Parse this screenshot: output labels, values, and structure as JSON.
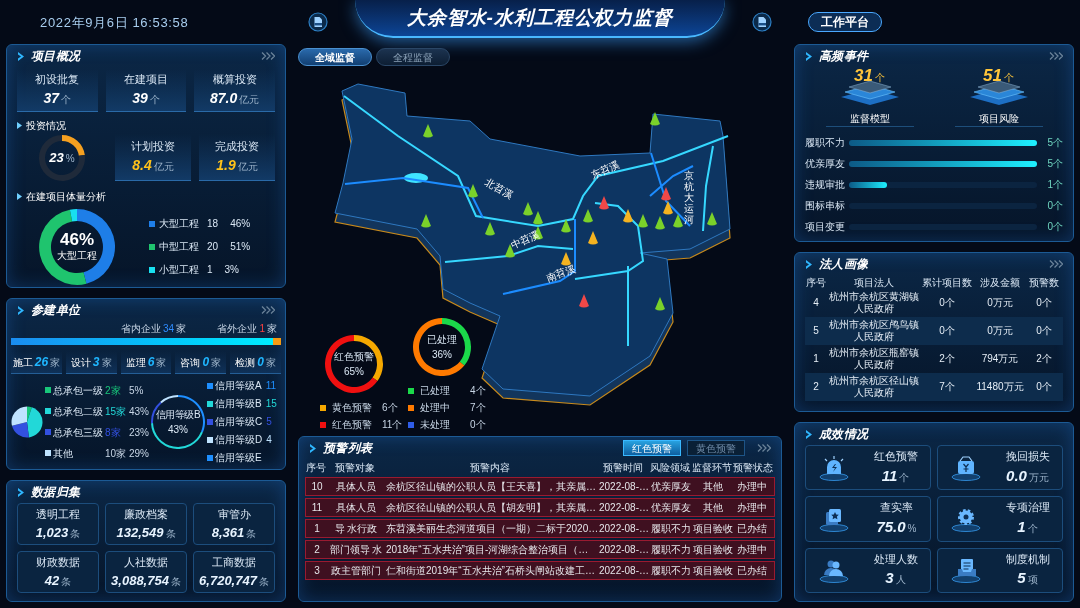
{
  "header": {
    "datetime": "2022年9月6日 16:53:58",
    "title": "大余智水-水利工程公权力监督",
    "workbench_button": "工作平台"
  },
  "overview": {
    "title": "项目概况",
    "stats": [
      {
        "label": "初设批复",
        "value": "37",
        "unit": "个"
      },
      {
        "label": "在建项目",
        "value": "39",
        "unit": "个"
      },
      {
        "label": "概算投资",
        "value": "87.0",
        "unit": "亿元"
      }
    ],
    "investment_title": "投资情况",
    "investment_ring": {
      "value": "23",
      "unit": "%",
      "chart_data": {
        "type": "donut",
        "values": [
          23,
          77
        ]
      }
    },
    "investment_stats": [
      {
        "label": "计划投资",
        "value": "8.4",
        "unit": "亿元"
      },
      {
        "label": "完成投资",
        "value": "1.9",
        "unit": "亿元"
      }
    ],
    "scale_title": "在建项目体量分析",
    "scale_center": {
      "value": "46%",
      "label": "大型工程"
    },
    "chart_data": {
      "type": "donut",
      "categories": [
        "大型工程",
        "中型工程",
        "小型工程"
      ],
      "values": [
        46,
        51,
        3
      ]
    },
    "scale_legend": [
      {
        "count": "18",
        "percent": "46%",
        "color": "#1e7ee8"
      },
      {
        "count": "20",
        "percent": "51%",
        "color": "#1fc46e"
      },
      {
        "count": "1",
        "percent": "3%",
        "color": "#18e0f0"
      }
    ]
  },
  "builders": {
    "title": "参建单位",
    "inside": {
      "label": "省内企业",
      "count": "34",
      "unit": "家",
      "level": 0.97
    },
    "outside": {
      "label": "省外企业",
      "count": "1",
      "unit": "家"
    },
    "types": [
      {
        "label": "施工",
        "count": "26",
        "unit": "家"
      },
      {
        "label": "设计",
        "count": "3",
        "unit": "家"
      },
      {
        "label": "监理",
        "count": "6",
        "unit": "家"
      },
      {
        "label": "咨询",
        "count": "0",
        "unit": "家"
      },
      {
        "label": "检测",
        "count": "0",
        "unit": "家"
      }
    ],
    "tier": {
      "chart_data": {
        "type": "pie",
        "categories": [
          "总承包一级",
          "总承包二级",
          "总承包三级",
          "其他"
        ],
        "values": [
          5,
          43,
          23,
          29
        ]
      },
      "legend": [
        {
          "count": "2家",
          "percent": "5%",
          "color": "#18c77a"
        },
        {
          "count": "15家",
          "percent": "43%",
          "color": "#22d8d8"
        },
        {
          "count": "8家",
          "percent": "23%",
          "color": "#3350e0"
        },
        {
          "count": "10家",
          "percent": "29%",
          "color": "#bfe3ff"
        }
      ]
    },
    "credit": {
      "center_label": "信用等级B",
      "center_value": "43%",
      "chart_data": {
        "type": "donut",
        "categories": [
          "信用等级A",
          "信用等级B",
          "信用等级C",
          "信用等级D",
          "信用等级E"
        ],
        "values": [
          31.4,
          42.9,
          14.3,
          11.4,
          0
        ]
      },
      "legend": [
        {
          "count": "11",
          "color": "#1e8fff"
        },
        {
          "count": "15",
          "color": "#22d8d8"
        },
        {
          "count": "5",
          "color": "#3350e0"
        },
        {
          "count": "4",
          "color": "#bfe3ff"
        },
        {
          "color": "#1e8fff"
        }
      ]
    }
  },
  "data_collection": {
    "title": "数据归集",
    "cards": [
      {
        "label": "透明工程",
        "value": "1,023",
        "unit": "条"
      },
      {
        "label": "廉政档案",
        "value": "132,549",
        "unit": "条"
      },
      {
        "label": "审管办",
        "value": "8,361",
        "unit": "条"
      },
      {
        "label": "财政数据",
        "value": "42",
        "unit": "条"
      },
      {
        "label": "人社数据",
        "value": "3,088,754",
        "unit": "条"
      },
      {
        "label": "工商数据",
        "value": "6,720,747",
        "unit": "条"
      }
    ]
  },
  "map_tabs": [
    {
      "label": "全域监督",
      "selected": true
    },
    {
      "label": "全程监督",
      "selected": false
    }
  ],
  "map": {
    "labels": [
      {
        "text": "北苕溪",
        "kind": "horizontal"
      },
      {
        "text": "中苕溪",
        "kind": "horizontal"
      },
      {
        "text": "南苕溪",
        "kind": "horizontal"
      },
      {
        "text": "东苕溪",
        "kind": "horizontal"
      },
      {
        "text": "京杭大运河",
        "kind": "vertical"
      }
    ]
  },
  "warning_chart": {
    "center_label": "红色预警",
    "center_value": "65%",
    "chart_data": {
      "type": "donut",
      "categories": [
        "黄色预警",
        "红色预警"
      ],
      "values": [
        35,
        65
      ]
    },
    "legend": [
      {
        "count": "6个",
        "color": "#f5a800"
      },
      {
        "count": "11个",
        "color": "#f01010"
      }
    ]
  },
  "status_chart": {
    "center_label": "已处理",
    "center_value": "36%",
    "chart_data": {
      "type": "donut",
      "categories": [
        "已处理",
        "处理中",
        "未处理"
      ],
      "values": [
        36,
        64,
        0
      ]
    },
    "legend": [
      {
        "count": "4个",
        "color": "#1bd94a"
      },
      {
        "count": "7个",
        "color": "#ff7a00"
      },
      {
        "count": "0个",
        "color": "#2f5de8"
      }
    ]
  },
  "warning_list": {
    "title": "预警列表",
    "tabs": [
      {
        "label": "红色预警",
        "selected": true
      },
      {
        "label": "黄色预警",
        "selected": false
      }
    ],
    "columns": [
      "序号",
      "预警对象",
      "预警内容",
      "预警时间",
      "风险领域",
      "监督环节",
      "预警状态"
    ],
    "rows": [
      [
        "10",
        "具体人员",
        "余杭区径山镇的公职人员【王天喜】，其亲属…",
        "2022-08-…",
        "优亲厚友",
        "其他",
        "办理中"
      ],
      [
        "11",
        "具体人员",
        "余杭区径山镇的公职人员【胡友明】，其亲属…",
        "2022-08-…",
        "优亲厚友",
        "其他",
        "办理中"
      ],
      [
        "1",
        "导 水行政",
        "东苕溪美丽生态河道项目（一期）二标于2020…",
        "2022-08-…",
        "履职不力",
        "项目验收",
        "已办结"
      ],
      [
        "2",
        "部门领导 水",
        "2018年“五水共治”项目-河湖综合整治项目（…",
        "2022-08-…",
        "履职不力",
        "项目验收",
        "办理中"
      ],
      [
        "3",
        "政主管部门",
        "仁和街道2019年“五水共治”石桥头闸站改建工…",
        "2022-08-…",
        "履职不力",
        "项目验收",
        "已办结"
      ]
    ]
  },
  "events": {
    "title": "高频事件",
    "highlights": [
      {
        "value": "31",
        "unit": "个",
        "label": "监督模型"
      },
      {
        "value": "51",
        "unit": "个",
        "label": "项目风险"
      }
    ],
    "bars": [
      {
        "label": "履职不力",
        "level": 1,
        "count": "5个"
      },
      {
        "label": "优亲厚友",
        "level": 1,
        "count": "5个"
      },
      {
        "label": "违规审批",
        "level": 0.2,
        "count": "1个"
      },
      {
        "label": "围标串标",
        "level": 0,
        "count": "0个"
      },
      {
        "label": "项目变更",
        "level": 0,
        "count": "0个"
      }
    ]
  },
  "legal": {
    "title": "法人画像",
    "columns": [
      "序号",
      "项目法人",
      "累计项目数",
      "涉及金额",
      "预警数"
    ],
    "rows": [
      [
        "4",
        "杭州市余杭区黄湖镇人民政府",
        "0个",
        "0万元",
        "0个"
      ],
      [
        "5",
        "杭州市余杭区鸬鸟镇人民政府",
        "0个",
        "0万元",
        "0个"
      ],
      [
        "1",
        "杭州市余杭区瓶窑镇人民政府",
        "2个",
        "794万元",
        "2个"
      ],
      [
        "2",
        "杭州市余杭区径山镇人民政府",
        "7个",
        "11480万元",
        "0个"
      ]
    ]
  },
  "results": {
    "title": "成效情况",
    "cards": [
      {
        "kind": "alarm",
        "label": "红色预警",
        "value": "11",
        "unit": "个"
      },
      {
        "kind": "money",
        "label": "挽回损失",
        "value": "0.0",
        "unit": "万元"
      },
      {
        "kind": "star",
        "label": "查实率",
        "value": "75.0",
        "unit": "%"
      },
      {
        "kind": "gear",
        "label": "专项治理",
        "value": "1",
        "unit": "个"
      },
      {
        "kind": "people",
        "label": "处理人数",
        "value": "3",
        "unit": "人"
      },
      {
        "kind": "document",
        "label": "制度机制",
        "value": "5",
        "unit": "项"
      }
    ]
  }
}
